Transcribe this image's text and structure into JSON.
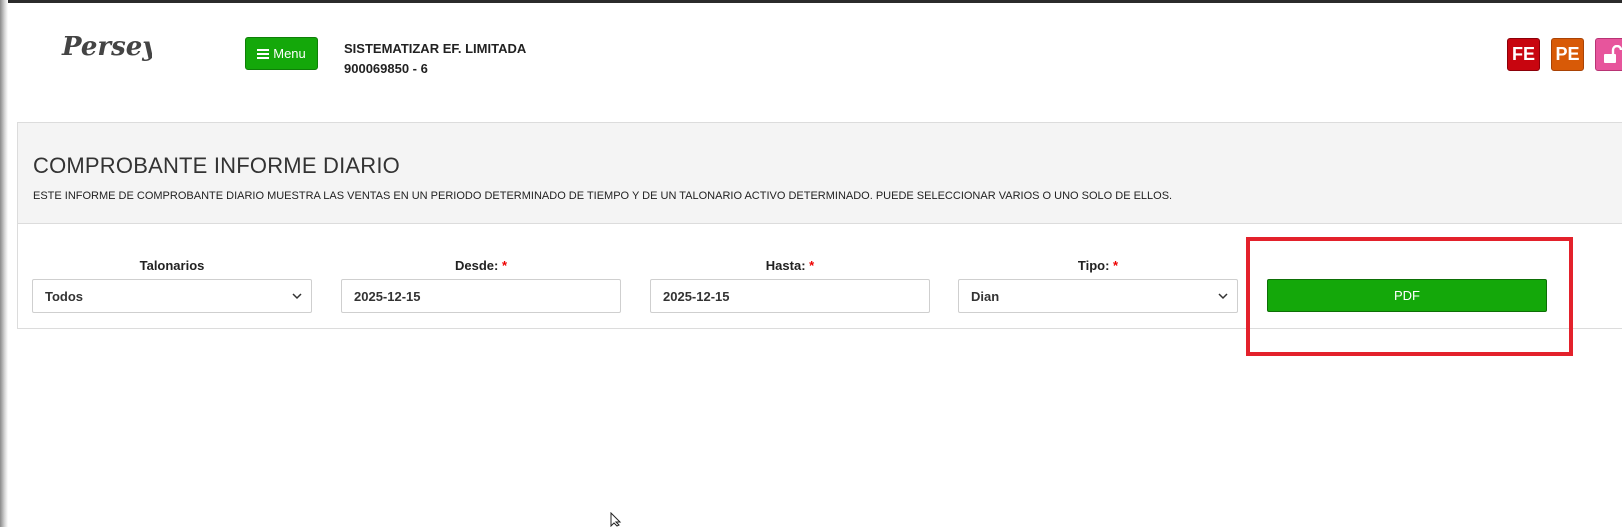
{
  "header": {
    "logo_text": "Persey",
    "menu_label": "Menu",
    "company_name": "SISTEMATIZAR EF. LIMITADA",
    "company_nit": "900069850 - 6",
    "icons": [
      {
        "name": "fe-icon",
        "label": "FE",
        "color": "#c8050f"
      },
      {
        "name": "pe-icon",
        "label": "PE",
        "color": "#d85a07"
      },
      {
        "name": "unlock-icon",
        "label": "",
        "color": "#e7559c"
      }
    ]
  },
  "report": {
    "title": "COMPROBANTE INFORME DIARIO",
    "description": "ESTE INFORME DE COMPROBANTE DIARIO MUESTRA LAS VENTAS EN UN PERIODO DETERMINADO DE TIEMPO Y DE UN TALONARIO ACTIVO DETERMINADO. PUEDE SELECCIONAR VARIOS O UNO SOLO DE ELLOS."
  },
  "form": {
    "talonarios_label": "Talonarios",
    "talonarios_value": "Todos",
    "desde_label": "Desde:",
    "desde_value": "2025-12-15",
    "hasta_label": "Hasta:",
    "hasta_value": "2025-12-15",
    "tipo_label": "Tipo:",
    "tipo_value": "Dian",
    "required_mark": "*",
    "pdf_label": "PDF"
  },
  "colors": {
    "accent_green": "#14a80a",
    "highlight_red": "#e3212b"
  }
}
